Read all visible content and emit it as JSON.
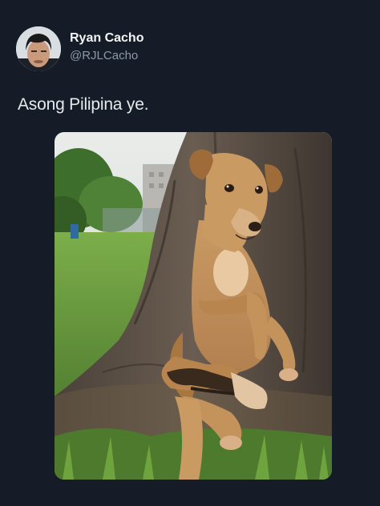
{
  "author": {
    "display_name": "Ryan Cacho",
    "handle": "@RJLCacho",
    "avatar_icon": "profile-photo"
  },
  "tweet": {
    "text": "Asong Pilipina ye."
  },
  "media": {
    "icon": "dog-photo"
  },
  "colors": {
    "background": "#151c28",
    "primary_text": "#e7e9ea",
    "secondary_text": "#8b98a5"
  }
}
